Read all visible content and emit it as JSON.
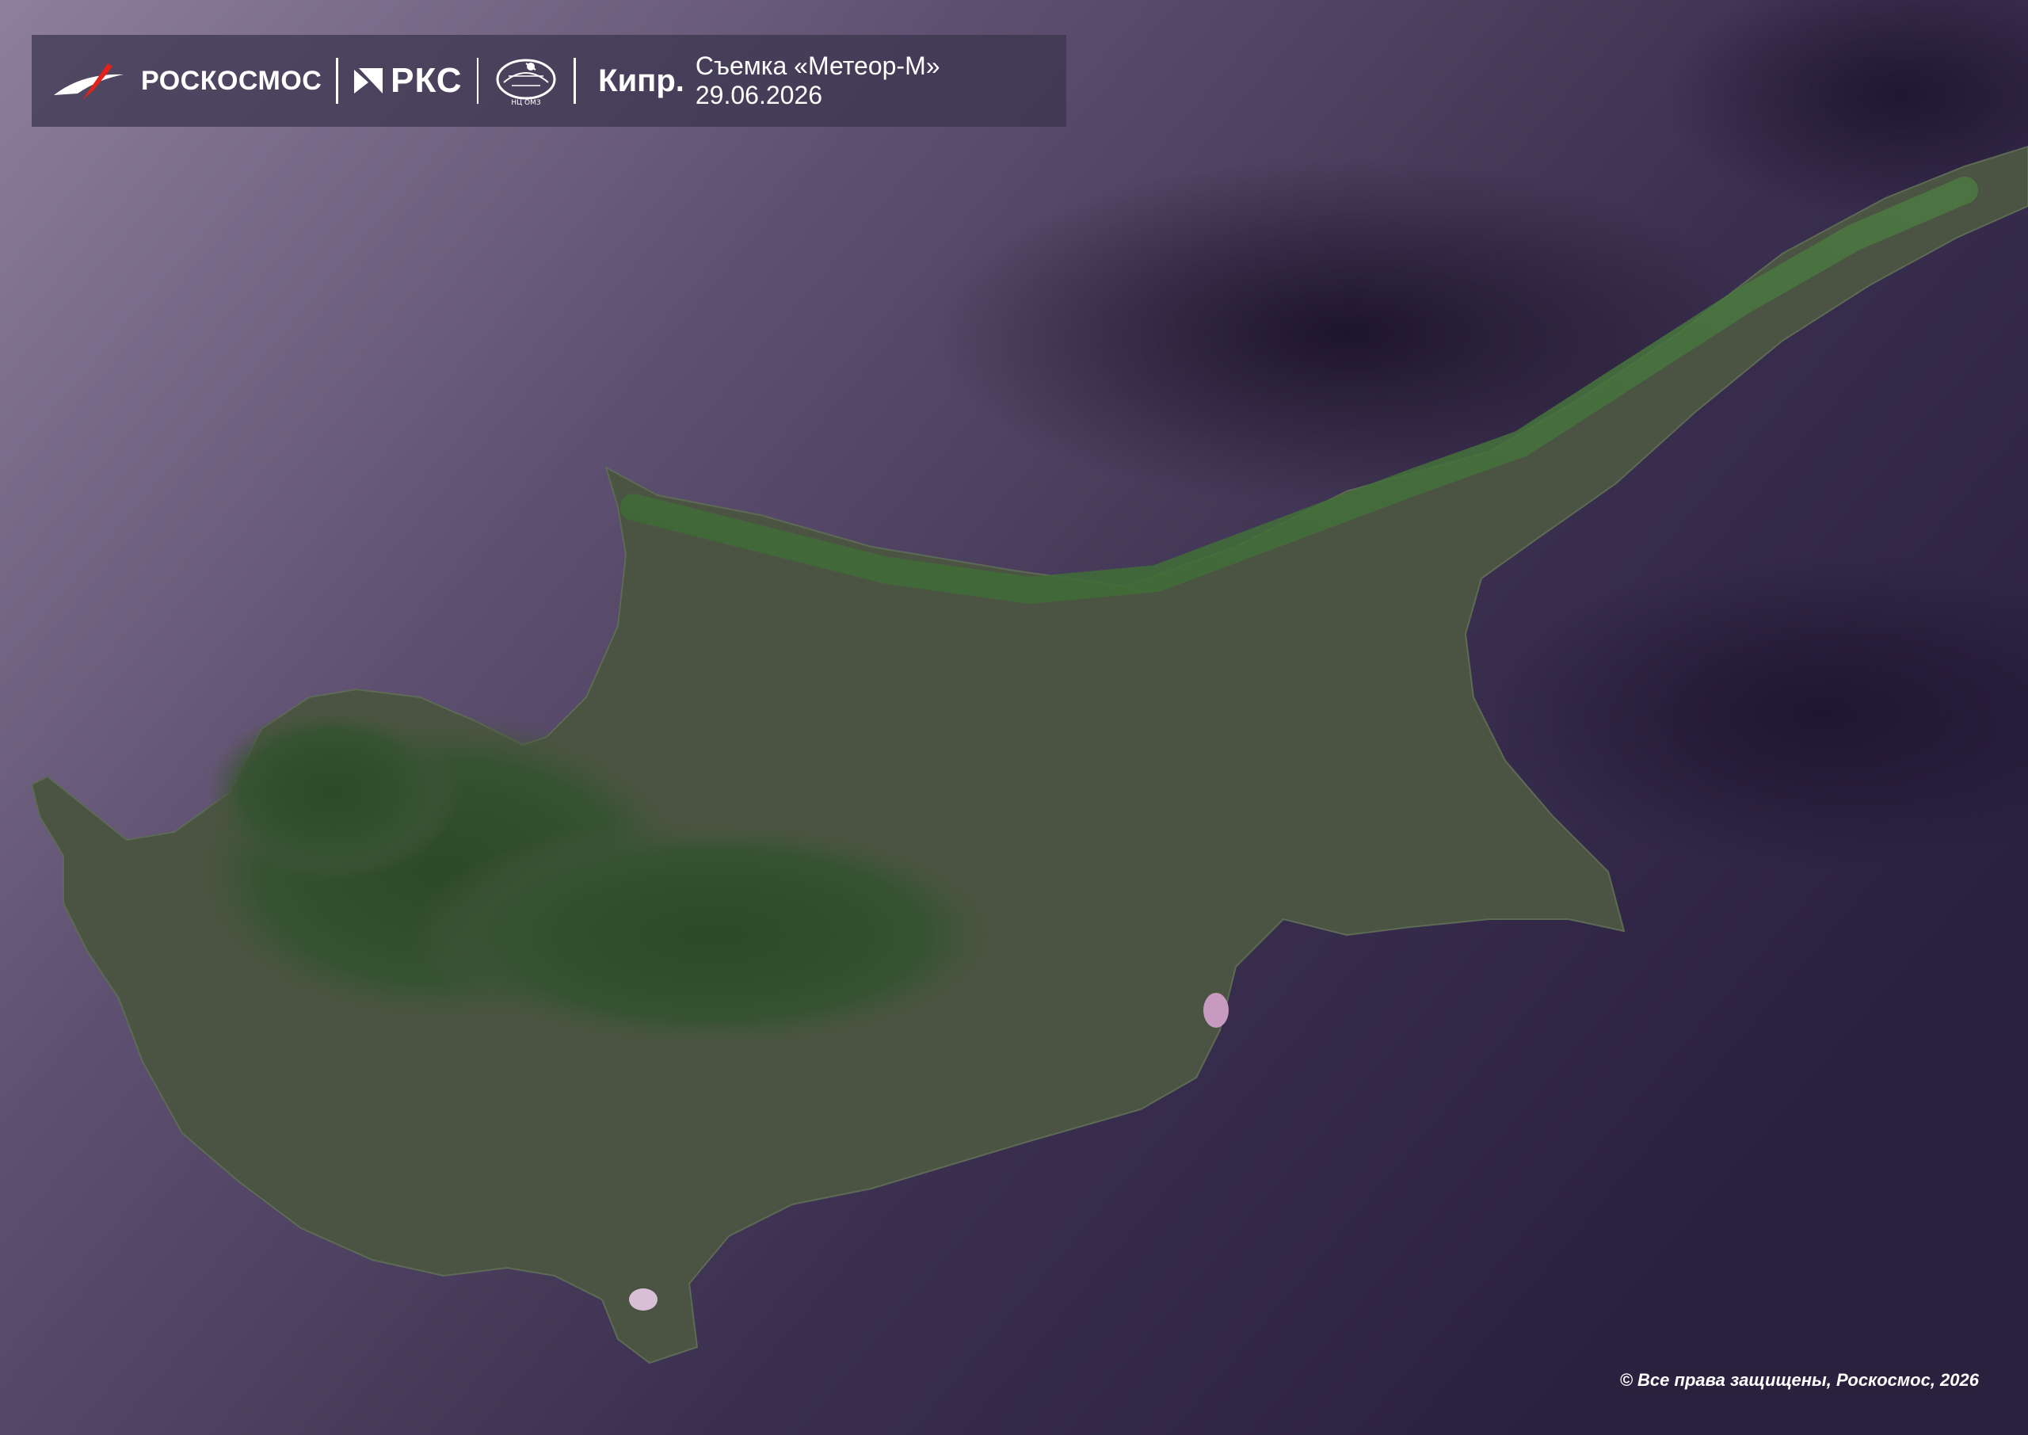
{
  "header": {
    "brand": "РОСКОСМОС",
    "rks": "РКС",
    "ntsomz": "НЦ ОМЗ",
    "title": "Кипр.",
    "subtitle": "Съемка «Метеор-М» 29.06.2026"
  },
  "footer": {
    "copyright": "© Все права защищены, Роскосмос, 2026"
  },
  "colors": {
    "sea": "#3b3150",
    "land": "#4a5340",
    "mountains": "#2f4a2a",
    "logo_red": "#e2231a",
    "text": "#ffffff"
  }
}
